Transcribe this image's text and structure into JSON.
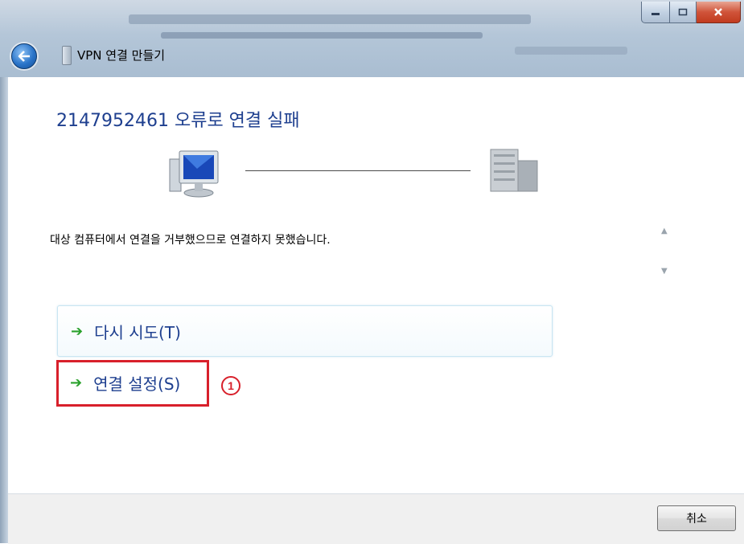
{
  "window": {
    "title": "VPN 연결 만들기",
    "buttons": {
      "minimize": "minimize",
      "maximize": "maximize",
      "close": "close"
    }
  },
  "main": {
    "heading": "2147952461 오류로 연결 실패",
    "message": "대상 컴퓨터에서 연결을 거부했으므로 연결하지 못했습니다.",
    "scroll": {
      "up": "▲",
      "down": "▼"
    },
    "links": [
      {
        "label": "다시 시도(T)",
        "icon": "green-arrow-icon"
      },
      {
        "label": "연결 설정(S)",
        "icon": "green-arrow-icon"
      }
    ]
  },
  "annotation": {
    "marker": "1",
    "color": "#d8202b"
  },
  "footer": {
    "cancel_label": "취소"
  },
  "colors": {
    "heading": "#1e3f8f",
    "arrow": "#2aa12c",
    "titlebar": "#b4c6d8"
  }
}
